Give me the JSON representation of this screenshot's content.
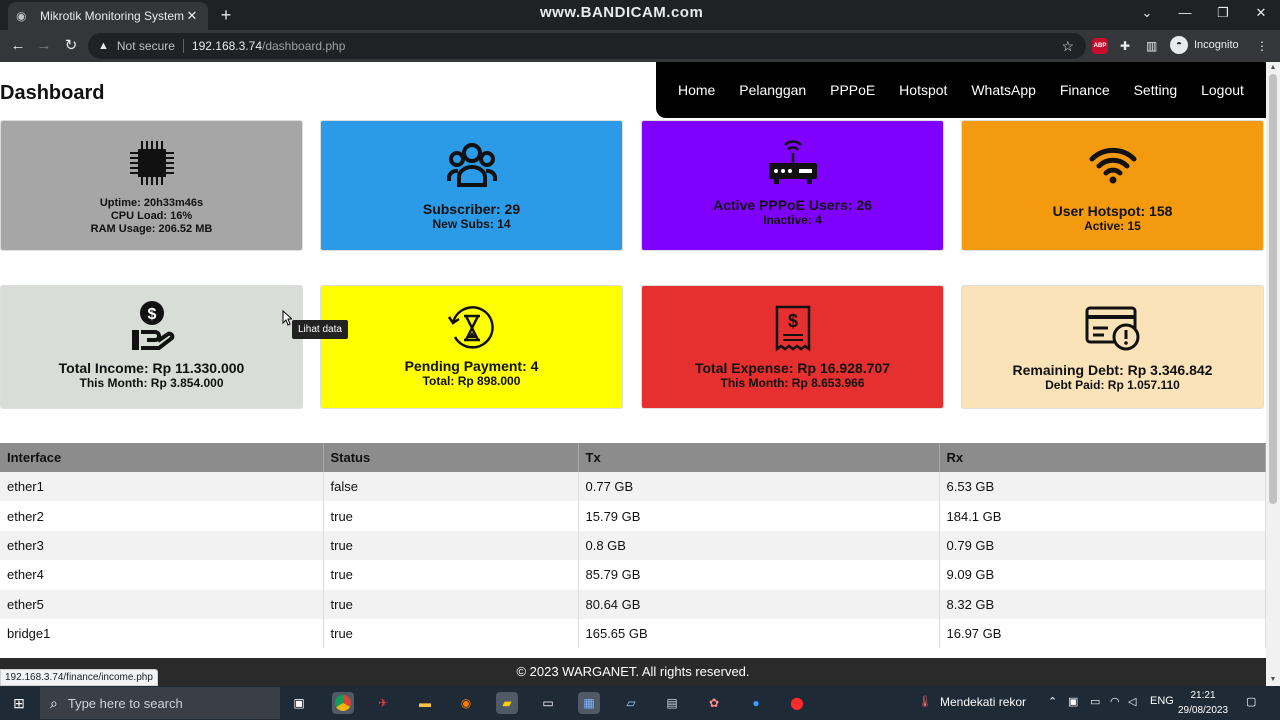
{
  "browser": {
    "tab_title": "Mikrotik Monitoring System",
    "watermark": "www.BANDICAM.com",
    "not_secure": "Not secure",
    "url_host": "192.168.3.74",
    "url_path": "/dashboard.php",
    "profile": "Incognito",
    "abp_label": "ABP",
    "status_url": "192.168.3.74/finance/income.php"
  },
  "page": {
    "title": "Dashboard"
  },
  "nav": [
    "Home",
    "Pelanggan",
    "PPPoE",
    "Hotspot",
    "WhatsApp",
    "Finance",
    "Setting",
    "Logout"
  ],
  "cards": {
    "system": {
      "uptime": "Uptime: 20h33m46s",
      "cpu": "CPU Load: 16%",
      "ram": "RAM Usage: 206.52 MB",
      "color": "#a6a6a6"
    },
    "subscriber": {
      "line1": "Subscriber: 29",
      "line2": "New Subs: 14",
      "color": "#2b9be8"
    },
    "pppoe": {
      "line1": "Active PPPoE Users: 26",
      "line2": "Inactive: 4",
      "color": "#8000ff"
    },
    "hotspot": {
      "line1": "User Hotspot: 158",
      "line2": "Active: 15",
      "color": "#f49a0f"
    },
    "income": {
      "line1": "Total Income: Rp 11.330.000",
      "line2": "This Month: Rp 3.854.000",
      "color": "#d8ddd8"
    },
    "pending": {
      "line1": "Pending Payment: 4",
      "line2": "Total: Rp 898.000",
      "color": "#ffff00"
    },
    "expense": {
      "line1": "Total Expense: Rp 16.928.707",
      "line2": "This Month: Rp 8.653.966",
      "color": "#e62f2f"
    },
    "debt": {
      "line1": "Remaining Debt: Rp 3.346.842",
      "line2": "Debt Paid: Rp 1.057.110",
      "color": "#fae3b8"
    }
  },
  "tooltip": "Lihat data",
  "table": {
    "headers": [
      "Interface",
      "Status",
      "Tx",
      "Rx"
    ],
    "rows": [
      [
        "ether1",
        "false",
        "0.77 GB",
        "6.53 GB"
      ],
      [
        "ether2",
        "true",
        "15.79 GB",
        "184.1 GB"
      ],
      [
        "ether3",
        "true",
        "0.8 GB",
        "0.79 GB"
      ],
      [
        "ether4",
        "true",
        "85.79 GB",
        "9.09 GB"
      ],
      [
        "ether5",
        "true",
        "80.64 GB",
        "8.32 GB"
      ],
      [
        "bridge1",
        "true",
        "165.65 GB",
        "16.97 GB"
      ]
    ]
  },
  "footer": "© 2023 WARGANET. All rights reserved.",
  "taskbar": {
    "search_placeholder": "Type here to search",
    "weather": "Mendekati rekor",
    "lang": "ENG",
    "time": "21:21",
    "date": "29/08/2023"
  }
}
